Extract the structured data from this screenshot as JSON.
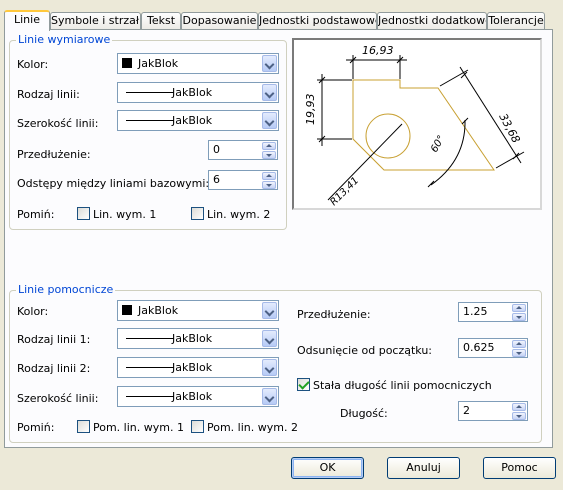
{
  "tabs": [
    {
      "label": "Linie",
      "active": true
    },
    {
      "label": "Symbole i strzałki",
      "active": false
    },
    {
      "label": "Tekst",
      "active": false
    },
    {
      "label": "Dopasowanie",
      "active": false
    },
    {
      "label": "Jednostki podstawowe",
      "active": false
    },
    {
      "label": "Jednostki dodatkowe",
      "active": false
    },
    {
      "label": "Tolerancje",
      "active": false
    }
  ],
  "dim_lines": {
    "title": "Linie wymiarowe",
    "color_label": "Kolor:",
    "color_value": "JakBlok",
    "linetype_label": "Rodzaj linii:",
    "linetype_value": "JakBlok",
    "lineweight_label": "Szerokość linii:",
    "lineweight_value": "JakBlok",
    "extend_label": "Przedłużenie:",
    "extend_value": "0",
    "baseline_label": "Odstępy między liniami bazowymi:",
    "baseline_value": "6",
    "suppress_label": "Pomiń:",
    "suppress_1_label": "Lin. wym. 1",
    "suppress_1_checked": false,
    "suppress_2_label": "Lin. wym. 2",
    "suppress_2_checked": false
  },
  "preview": {
    "dim_top": "16,93",
    "dim_left": "19,93",
    "dim_right": "33,68",
    "dim_angle": "60°",
    "dim_radius": "R13,41"
  },
  "ext_lines": {
    "title": "Linie pomocnicze",
    "color_label": "Kolor:",
    "color_value": "JakBlok",
    "linetype1_label": "Rodzaj linii 1:",
    "linetype1_value": "JakBlok",
    "linetype2_label": "Rodzaj linii 2:",
    "linetype2_value": "JakBlok",
    "lineweight_label": "Szerokość linii:",
    "lineweight_value": "JakBlok",
    "suppress_label": "Pomiń:",
    "suppress_1_label": "Pom. lin. wym. 1",
    "suppress_1_checked": false,
    "suppress_2_label": "Pom. lin. wym. 2",
    "suppress_2_checked": false,
    "extend_label": "Przedłużenie:",
    "extend_value": "1.25",
    "offset_label": "Odsunięcie od początku:",
    "offset_value": "0.625",
    "fixed_label": "Stała długość linii pomocniczych",
    "fixed_checked": true,
    "length_label": "Długość:",
    "length_value": "2"
  },
  "buttons": {
    "ok": "OK",
    "cancel": "Anuluj",
    "help": "Pomoc"
  },
  "colors": {
    "accent": "#0046d5",
    "preview_shape": "#c8a032",
    "tab_highlight": "#ffc83c"
  }
}
